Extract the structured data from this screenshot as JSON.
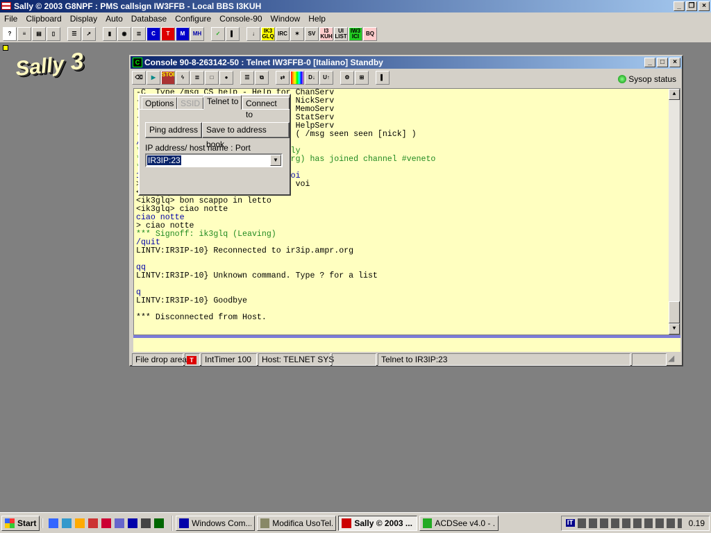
{
  "app": {
    "title": "Sally © 2003 G8NPF : PMS callsign IW3FFB - Local BBS I3KUH",
    "logo": "Sally 3"
  },
  "menu": [
    "File",
    "Clipboard",
    "Display",
    "Auto",
    "Database",
    "Configure",
    "Console-90",
    "Window",
    "Help"
  ],
  "toolbar": [
    {
      "icon": "help-icon",
      "label": "?"
    },
    {
      "icon": "list-icon",
      "label": "≡"
    },
    {
      "icon": "print-icon",
      "label": "▤"
    },
    {
      "icon": "new-doc-icon",
      "label": "▯"
    },
    {
      "icon": "gap"
    },
    {
      "icon": "edit-list-icon",
      "label": "☰"
    },
    {
      "icon": "send-icon",
      "label": "➚"
    },
    {
      "icon": "gap"
    },
    {
      "icon": "book-icon",
      "label": "▮"
    },
    {
      "icon": "binoculars-icon",
      "label": "◉"
    },
    {
      "icon": "scroll-icon",
      "label": "≣"
    },
    {
      "icon": "console-c-icon",
      "label": "C"
    },
    {
      "icon": "console-t-icon",
      "label": "T"
    },
    {
      "icon": "console-m-icon",
      "label": "M"
    },
    {
      "icon": "mh-icon",
      "label": "MH"
    },
    {
      "icon": "gap"
    },
    {
      "icon": "check-icon",
      "label": "✓"
    },
    {
      "icon": "exit-door-icon",
      "label": "▌"
    },
    {
      "icon": "gap"
    },
    {
      "icon": "down-arrow-icon",
      "label": "↓"
    },
    {
      "icon": "ik3glq-icon",
      "label": "IK3 GLQ"
    },
    {
      "icon": "irc-icon",
      "label": "IRC"
    },
    {
      "icon": "satellite-icon",
      "label": "✶"
    },
    {
      "icon": "sv-icon",
      "label": "SV"
    },
    {
      "icon": "i3kuh-icon",
      "label": "I3 KUH"
    },
    {
      "icon": "ui-list-icon",
      "label": "UI LIST"
    },
    {
      "icon": "iw3ici-icon",
      "label": "IW3 ICI"
    },
    {
      "icon": "bq-icon",
      "label": "BQ"
    }
  ],
  "child": {
    "title": "Console 90-8-263142-50 : Telnet IW3FFB-0 [Italiano]  Standby",
    "toolbar": [
      {
        "icon": "eraser-icon",
        "label": "⌫"
      },
      {
        "icon": "play-icon",
        "label": "▶"
      },
      {
        "icon": "stop-icon",
        "label": "STOP"
      },
      {
        "icon": "antenna-icon",
        "label": "ϟ"
      },
      {
        "icon": "scroll-icon",
        "label": "≣"
      },
      {
        "icon": "frame-icon",
        "label": "□"
      },
      {
        "icon": "record-icon",
        "label": "●"
      },
      {
        "icon": "gap"
      },
      {
        "icon": "new-list-icon",
        "label": "☰"
      },
      {
        "icon": "copy-icon",
        "label": "⧉"
      },
      {
        "icon": "gap"
      },
      {
        "icon": "switch-icon",
        "label": "⇄"
      },
      {
        "icon": "color-bars-icon",
        "label": ""
      },
      {
        "icon": "download-icon",
        "label": "D↓"
      },
      {
        "icon": "upload-icon",
        "label": "U↑"
      },
      {
        "icon": "gap"
      },
      {
        "icon": "gear-icon",
        "label": "⚙"
      },
      {
        "icon": "network-icon",
        "label": "⊞"
      },
      {
        "icon": "gap"
      },
      {
        "icon": "exit-door-icon",
        "label": "▌"
      }
    ],
    "sysop_status": "Sysop status",
    "lines": [
      {
        "t": "-C  Type /msg CS help - Help for ChanServ",
        "c": "black"
      },
      {
        "t": "-                                NickServ",
        "c": "black"
      },
      {
        "t": "-                                MemoServ",
        "c": "black"
      },
      {
        "t": "-                                StatServ",
        "c": "black"
      },
      {
        "t": "-                                HelpServ",
        "c": "black"
      },
      {
        "t": "-                                ( /msg seen seen [nick] )",
        "c": "black"
      },
      {
        "t": "/",
        "c": "blue"
      },
      {
        "t": "*                               ly",
        "c": "green"
      },
      {
        "t": "*                               rg) has joined channel #veneto",
        "c": "green"
      },
      {
        "t": "*",
        "c": "green"
      },
      {
        "t": "1                               oi",
        "c": "blue"
      },
      {
        "t": ">                                voi",
        "c": "black"
      },
      {
        "t": "<ik3glq> ok",
        "c": "black"
      },
      {
        "t": "<ik3glq> bon scappo in letto",
        "c": "black"
      },
      {
        "t": "<ik3glq> ciao notte",
        "c": "black"
      },
      {
        "t": "ciao notte",
        "c": "blue"
      },
      {
        "t": "> ciao notte",
        "c": "black"
      },
      {
        "t": "*** Signoff: ik3glq (Leaving)",
        "c": "green"
      },
      {
        "t": "/quit",
        "c": "blue"
      },
      {
        "t": "LINTV:IR3IP-10} Reconnected to ir3ip.ampr.org",
        "c": "black"
      },
      {
        "t": "",
        "c": "black"
      },
      {
        "t": "qq",
        "c": "blue"
      },
      {
        "t": "LINTV:IR3IP-10} Unknown command. Type ? for a list",
        "c": "black"
      },
      {
        "t": "",
        "c": "black"
      },
      {
        "t": "q",
        "c": "blue"
      },
      {
        "t": "LINTV:IR3IP-10} Goodbye",
        "c": "black"
      },
      {
        "t": "",
        "c": "black"
      },
      {
        "t": "*** Disconnected from Host.",
        "c": "black"
      }
    ],
    "input_value": "",
    "status": {
      "file_drop": "File drop area",
      "timer": "IntTimer 100",
      "host": "Host: TELNET SYS",
      "blank1": "",
      "telnet": "Telnet to   IR3IP:23",
      "blank2": ""
    }
  },
  "popup": {
    "tabs": [
      "Options",
      "SSID",
      "Telnet to",
      "Connect to"
    ],
    "active_tab": "Telnet to",
    "disabled_tab": "SSID",
    "ping": "Ping address",
    "save": "Save to address book",
    "address_label": "IP address/ host name : Port",
    "address_value": "IR3IP:23"
  },
  "taskbar": {
    "start": "Start",
    "quicklaunch": [
      "ie-icon",
      "outlook-icon",
      "media-player-icon",
      "app-icon",
      "app2-icon",
      "app3-icon",
      "save-icon",
      "robot-icon",
      "battery-icon"
    ],
    "tasks": [
      {
        "label": "Windows Com...",
        "icon": "floppy-icon",
        "active": false
      },
      {
        "label": "Modifica UsoTel...",
        "icon": "editor-icon",
        "active": false
      },
      {
        "label": "Sally © 2003 ...",
        "icon": "sally-flag-icon",
        "active": true
      },
      {
        "label": "ACDSee v4.0 - ...",
        "icon": "acdsee-icon",
        "active": false
      }
    ],
    "lang": "IT",
    "clock": "0.19"
  },
  "colors": {
    "titlebar": "#0a246a",
    "console_bg": "#ffffc0",
    "desktop": "#808080"
  }
}
